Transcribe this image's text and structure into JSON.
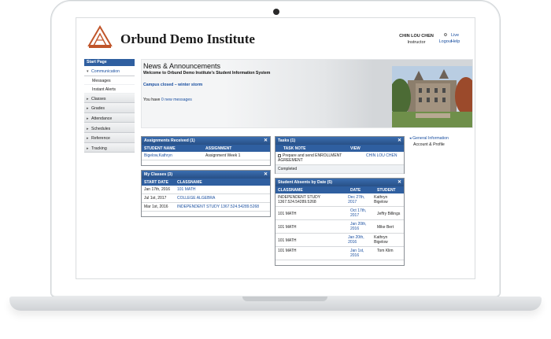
{
  "header": {
    "institution": "Orbund Demo Institute",
    "user_name": "CHIN LOU CHEN",
    "user_role": "Instructor",
    "logout": "Logout",
    "live": "Live",
    "help": "Help"
  },
  "sidebar": {
    "title": "Start Page",
    "items": [
      {
        "label": "Communication",
        "active": true,
        "sub": [
          "Messages",
          "Instant Alerts"
        ]
      },
      {
        "label": "Classes"
      },
      {
        "label": "Grades"
      },
      {
        "label": "Attendance"
      },
      {
        "label": "Schedules"
      },
      {
        "label": "Reference"
      },
      {
        "label": "Tracking"
      }
    ]
  },
  "news": {
    "title": "News & Announcements",
    "welcome": "Welcome to Orbund Demo Institute's Student Information System",
    "campus": "Campus closed – winter storm",
    "msgs_prefix": "You have",
    "msgs_link": "0 new messages"
  },
  "assignments": {
    "title": "Assignments Received (1)",
    "headers": [
      "STUDENT NAME",
      "ASSIGNMENT"
    ],
    "rows": [
      [
        "Bigelow,Kathryn",
        "Assignment Week 1"
      ]
    ]
  },
  "classes": {
    "title": "My Classes (3)",
    "headers": [
      "START DATE",
      "CLASSNAME"
    ],
    "rows": [
      [
        "Jan 17th, 2016",
        "101 MATH"
      ],
      [
        "Jul 1st, 2017",
        "COLLEGE ALGEBRA"
      ],
      [
        "Mar 1st, 2016",
        "INDEPENDENT STUDY 1367.524.54289.5268"
      ]
    ]
  },
  "tasks": {
    "title": "Tasks (1)",
    "headers": [
      "TASK NOTE",
      "VIEW"
    ],
    "rows": [
      [
        "Prepare and send ENROLLMENT AGREEMENT",
        "CHIN LOU CHEN"
      ]
    ],
    "completed": "Completed"
  },
  "absents": {
    "title": "Student Absents by Date (5)",
    "headers": [
      "CLASSNAME",
      "DATE",
      "STUDENT"
    ],
    "rows": [
      [
        "INDEPENDENT STUDY 1367.524.54289.5268",
        "Dec 27th, 2017",
        "Kathryn Bigelow"
      ],
      [
        "101 MATH",
        "Oct 17th, 2017",
        "Jeffry Billings"
      ],
      [
        "101 MATH",
        "Jan 20th, 2016",
        "Mike Bert"
      ],
      [
        "101 MATH",
        "Jan 20th, 2016",
        "Kathryn Bigelow"
      ],
      [
        "101 MATH",
        "Jan 1st, 2016",
        "Tom Klim"
      ]
    ]
  },
  "general": {
    "title": "General Information",
    "item": "Account & Profile"
  },
  "colors": {
    "panel_header": "#2f5fa0",
    "link": "#1a4fa0",
    "logo": "#c0552a"
  },
  "icons": [
    "logo-icon",
    "gear-icon",
    "close-icon",
    "chevron-right-icon",
    "chevron-left-icon",
    "checkbox-icon"
  ]
}
